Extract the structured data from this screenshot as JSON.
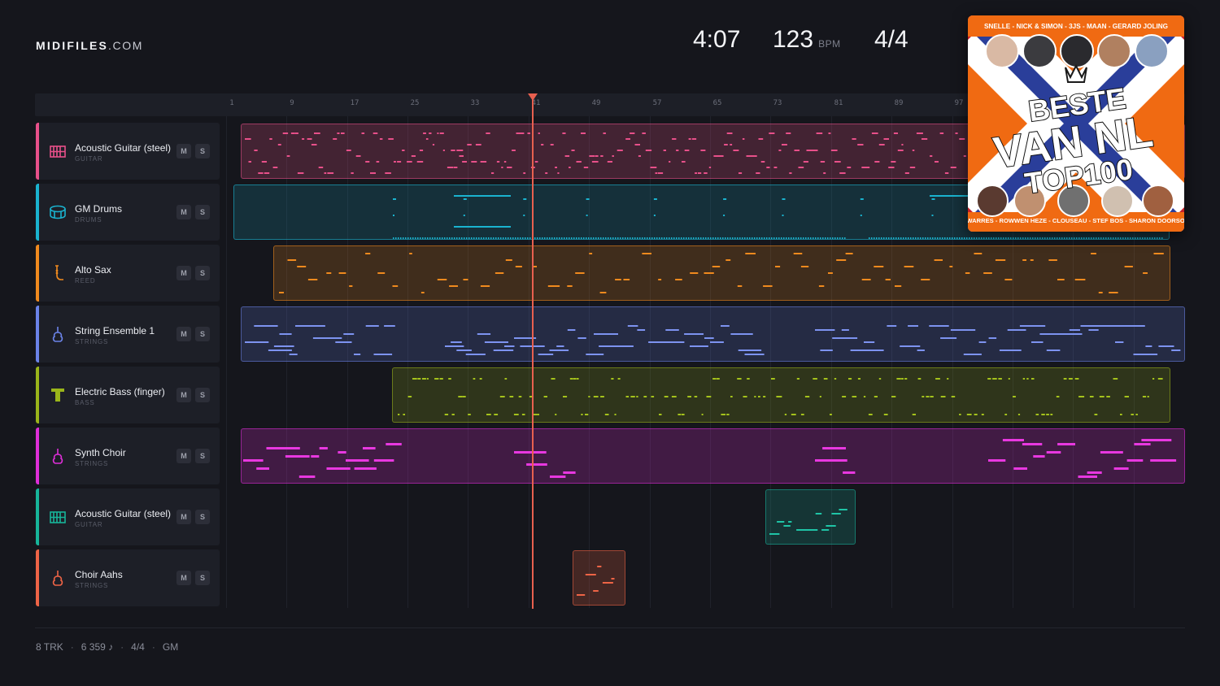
{
  "brand": {
    "name": "MIDIFILES",
    "domain": ".COM"
  },
  "header": {
    "duration": "4:07",
    "tempo": "123",
    "tempo_unit": "BPM",
    "time_signature": "4/4"
  },
  "ruler": {
    "ticks": [
      "1",
      "9",
      "17",
      "25",
      "33",
      "41",
      "49",
      "57",
      "65",
      "73",
      "81",
      "89",
      "97"
    ]
  },
  "tracks": [
    {
      "name": "Acoustic Guitar (steel)",
      "category": "GUITAR",
      "color": "#e8508a",
      "icon": "guitar-grid-icon",
      "mute": "M",
      "solo": "S"
    },
    {
      "name": "GM Drums",
      "category": "DRUMS",
      "color": "#1ab3cf",
      "icon": "drum-icon",
      "mute": "M",
      "solo": "S"
    },
    {
      "name": "Alto Sax",
      "category": "REED",
      "color": "#f08a1e",
      "icon": "saxophone-icon",
      "mute": "M",
      "solo": "S"
    },
    {
      "name": "String Ensemble 1",
      "category": "STRINGS",
      "color": "#6b83e8",
      "icon": "violin-icon",
      "mute": "M",
      "solo": "S"
    },
    {
      "name": "Electric Bass (finger)",
      "category": "BASS",
      "color": "#9ab51a",
      "icon": "bass-icon",
      "mute": "M",
      "solo": "S"
    },
    {
      "name": "Synth Choir",
      "category": "STRINGS",
      "color": "#de2ed8",
      "icon": "violin-icon",
      "mute": "M",
      "solo": "S"
    },
    {
      "name": "Acoustic Guitar (steel)",
      "category": "GUITAR",
      "color": "#17b59a",
      "icon": "guitar-grid-icon",
      "mute": "M",
      "solo": "S"
    },
    {
      "name": "Choir Aahs",
      "category": "STRINGS",
      "color": "#ee6446",
      "icon": "violin-icon",
      "mute": "M",
      "solo": "S"
    }
  ],
  "footer": {
    "tracks": "8 TRK",
    "notes": "6 359 ♪",
    "time_signature": "4/4",
    "standard": "GM"
  },
  "cover": {
    "top_artists": "SNELLE - NICK & SIMON - 3JS - MAAN - GERARD JOLING",
    "title_line1": "BESTE",
    "title_line2": "VAN NL",
    "title_line3": "TOP100",
    "bottom_artists": "TWARRES - ROWWEN HEZE - CLOUSEAU - STEF BOS - SHARON DOORSON"
  }
}
